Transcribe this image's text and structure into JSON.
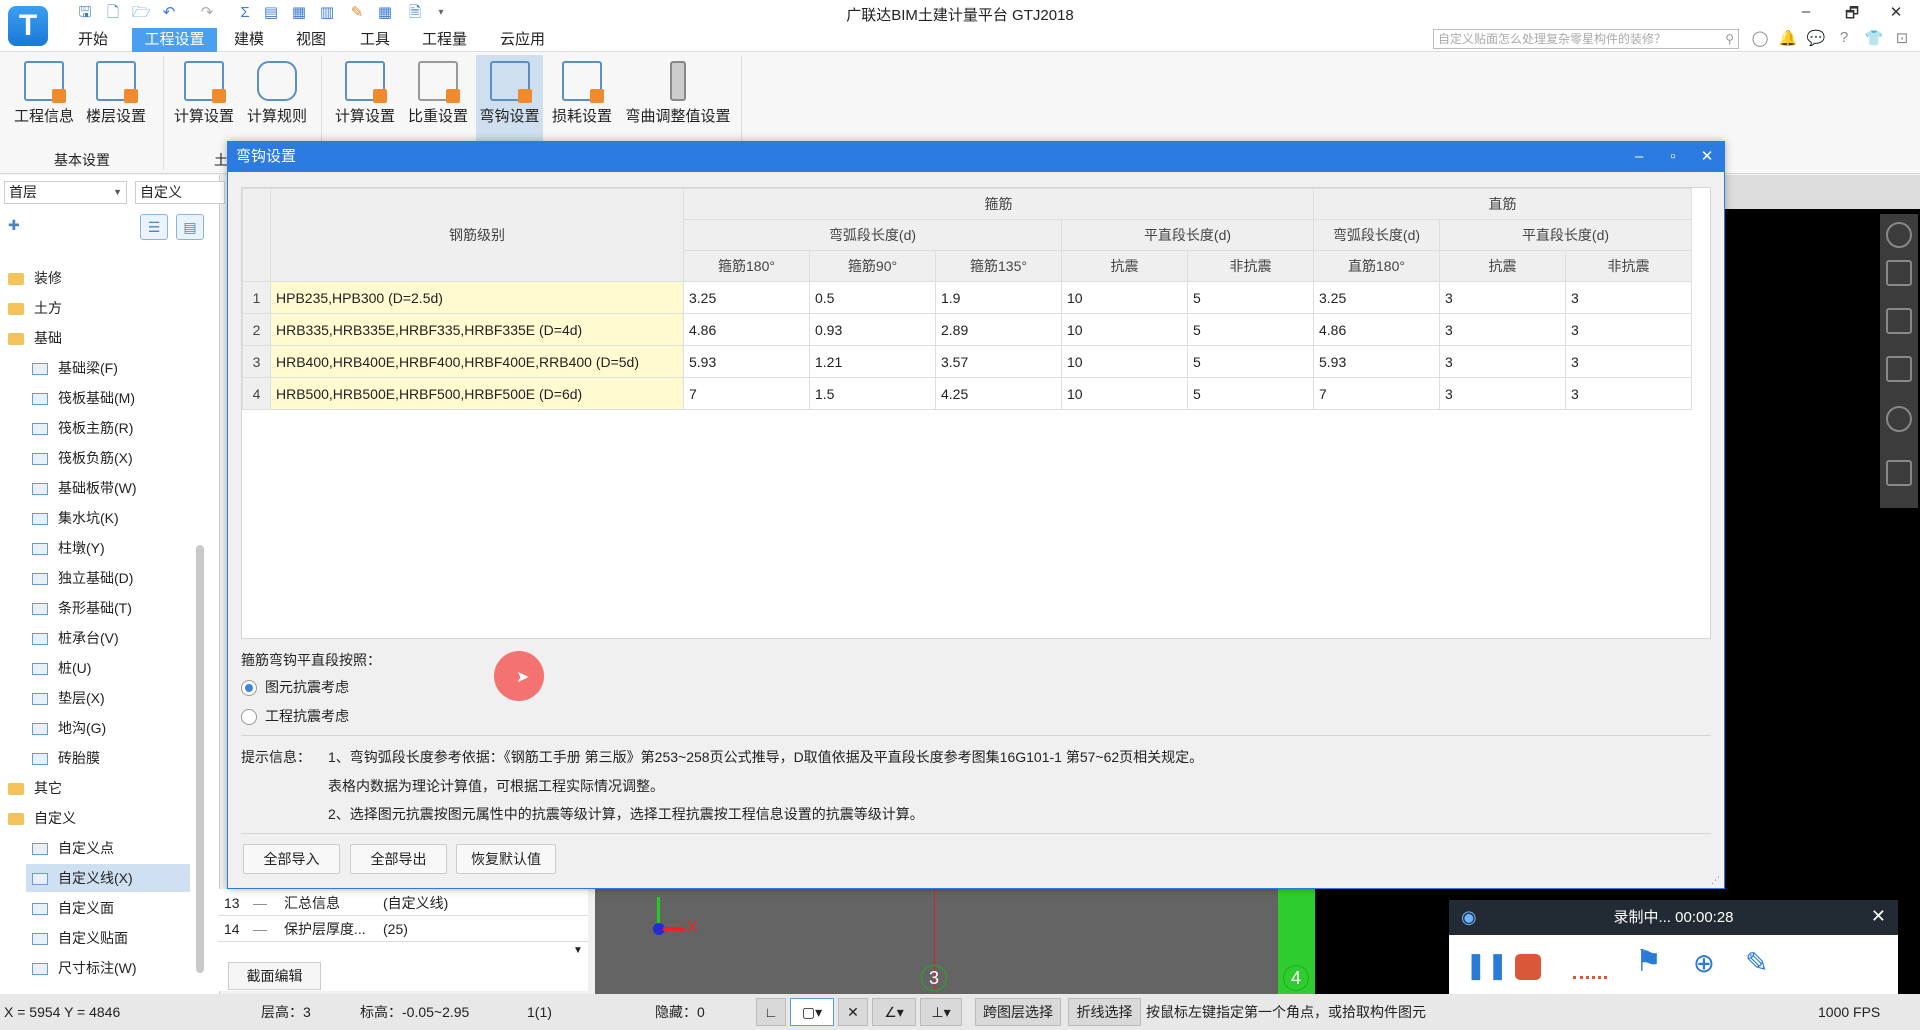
{
  "app": {
    "title": "广联达BIM土建计量平台 GTJ2018",
    "logo": "T",
    "window_controls": [
      "–",
      "🗗",
      "✕"
    ]
  },
  "menu": {
    "tabs": [
      "开始",
      "工程设置",
      "建模",
      "视图",
      "工具",
      "工程量",
      "云应用"
    ],
    "active": "工程设置"
  },
  "search": {
    "placeholder": "自定义贴面怎么处理复杂零星构件的装修？"
  },
  "ribbon": {
    "buttons": [
      "工程信息",
      "楼层设置",
      "计算设置",
      "计算规则",
      "计算设置",
      "比重设置",
      "弯钩设置",
      "损耗设置",
      "弯曲调整值设置"
    ],
    "active": "弯钩设置",
    "groups": [
      "基本设置",
      "土"
    ]
  },
  "left_panel": {
    "floor": "首层",
    "category": "自定义",
    "tree": [
      {
        "label": "装修",
        "type": "folder"
      },
      {
        "label": "土方",
        "type": "folder"
      },
      {
        "label": "基础",
        "type": "folder"
      },
      {
        "label": "基础梁(F)",
        "type": "leaf"
      },
      {
        "label": "筏板基础(M)",
        "type": "leaf"
      },
      {
        "label": "筏板主筋(R)",
        "type": "leaf"
      },
      {
        "label": "筏板负筋(X)",
        "type": "leaf"
      },
      {
        "label": "基础板带(W)",
        "type": "leaf"
      },
      {
        "label": "集水坑(K)",
        "type": "leaf"
      },
      {
        "label": "柱墩(Y)",
        "type": "leaf"
      },
      {
        "label": "独立基础(D)",
        "type": "leaf"
      },
      {
        "label": "条形基础(T)",
        "type": "leaf"
      },
      {
        "label": "桩承台(V)",
        "type": "leaf"
      },
      {
        "label": "桩(U)",
        "type": "leaf"
      },
      {
        "label": "垫层(X)",
        "type": "leaf"
      },
      {
        "label": "地沟(G)",
        "type": "leaf"
      },
      {
        "label": "砖胎膜",
        "type": "leaf"
      },
      {
        "label": "其它",
        "type": "folder"
      },
      {
        "label": "自定义",
        "type": "folder"
      },
      {
        "label": "自定义点",
        "type": "leaf"
      },
      {
        "label": "自定义线(X)",
        "type": "leaf",
        "selected": true
      },
      {
        "label": "自定义面",
        "type": "leaf"
      },
      {
        "label": "自定义贴面",
        "type": "leaf"
      },
      {
        "label": "尺寸标注(W)",
        "type": "leaf"
      }
    ]
  },
  "properties": {
    "rows": [
      {
        "num": "13",
        "name": "汇总信息",
        "value": "(自定义线)"
      },
      {
        "num": "14",
        "name": "保护层厚度...",
        "value": "(25)"
      }
    ],
    "section_edit": "截面编辑"
  },
  "canvas": {
    "axis_x": "X",
    "grid_labels": [
      "3",
      "4"
    ]
  },
  "dialog": {
    "title": "弯钩设置",
    "table": {
      "col_header": "钢筋级别",
      "group_stirrup": "箍筋",
      "group_straight": "直筋",
      "arc_length": "弯弧段长度(d)",
      "straight_length": "平直段长度(d)",
      "sub_headers": [
        "箍筋180°",
        "箍筋90°",
        "箍筋135°",
        "抗震",
        "非抗震",
        "直筋180°",
        "抗震",
        "非抗震"
      ],
      "rows": [
        {
          "num": "1",
          "grade": "HPB235,HPB300 (D=2.5d)",
          "values": [
            "3.25",
            "0.5",
            "1.9",
            "10",
            "5",
            "3.25",
            "3",
            "3"
          ]
        },
        {
          "num": "2",
          "grade": "HRB335,HRB335E,HRBF335,HRBF335E (D=4d)",
          "values": [
            "4.86",
            "0.93",
            "2.89",
            "10",
            "5",
            "4.86",
            "3",
            "3"
          ]
        },
        {
          "num": "3",
          "grade": "HRB400,HRB400E,HRBF400,HRBF400E,RRB400 (D=5d)",
          "values": [
            "5.93",
            "1.21",
            "3.57",
            "10",
            "5",
            "5.93",
            "3",
            "3"
          ]
        },
        {
          "num": "4",
          "grade": "HRB500,HRB500E,HRBF500,HRBF500E (D=6d)",
          "values": [
            "7",
            "1.5",
            "4.25",
            "10",
            "5",
            "7",
            "3",
            "3"
          ]
        }
      ]
    },
    "option_label": "箍筋弯钩平直段按照：",
    "options": [
      {
        "label": "图元抗震考虑",
        "checked": true
      },
      {
        "label": "工程抗震考虑",
        "checked": false
      }
    ],
    "hint_label": "提示信息：",
    "hints": [
      "1、弯钩弧段长度参考依据：《钢筋工手册 第三版》第253~258页公式推导，D取值依据及平直段长度参考图集16G101-1 第57~62页相关规定。",
      "表格内数据为理论计算值，可根据工程实际情况调整。",
      "2、选择图元抗震按图元属性中的抗震等级计算，选择工程抗震按工程信息设置的抗震等级计算。"
    ],
    "buttons": [
      "全部导入",
      "全部导出",
      "恢复默认值"
    ]
  },
  "recorder": {
    "status": "录制中... 00:00:28"
  },
  "status_bar": {
    "coords": "X = 5954 Y = 4846",
    "floor_height": "层高：3",
    "elevation": "标高：-0.05~2.95",
    "count": "1(1)",
    "hidden": "隐藏：0",
    "cross_layer": "跨图层选择",
    "polyline_select": "折线选择",
    "prompt": "按鼠标左键指定第一个角点，或拾取构件图元",
    "fps": "1000 FPS"
  },
  "colors": {
    "accent": "#2c7be0",
    "grade_cell": "#fffbd0",
    "active_ribbon": "#cfdff0"
  }
}
